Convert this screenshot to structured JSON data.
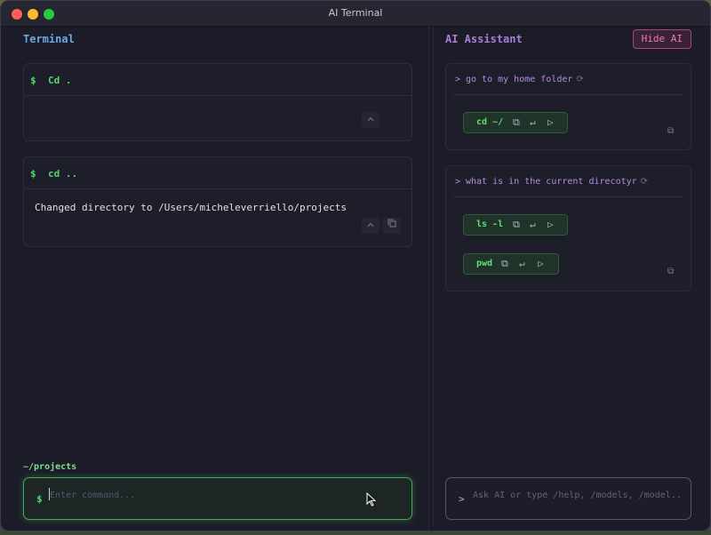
{
  "window": {
    "title": "AI Terminal"
  },
  "terminal": {
    "title": "Terminal",
    "blocks": [
      {
        "prompt": "$",
        "command": "Cd .",
        "output": ""
      },
      {
        "prompt": "$",
        "command": "cd ..",
        "output": "Changed directory to /Users/micheleverriello/projects"
      }
    ],
    "cwd": "~/projects",
    "input": {
      "prompt": "$",
      "placeholder": "Enter command...",
      "value": ""
    }
  },
  "assistant": {
    "title": "AI Assistant",
    "hide_label": "Hide AI",
    "cards": [
      {
        "prompt": ">",
        "query": "go to my home folder",
        "suggestions": [
          "cd ~/"
        ]
      },
      {
        "prompt": ">",
        "query": "what is in the current direcotyr",
        "suggestions": [
          "ls -l",
          "pwd"
        ]
      }
    ],
    "input": {
      "prompt": ">",
      "placeholder": "Ask AI or type /help, /models, /model...",
      "value": ""
    }
  },
  "icons": {
    "collapse": "chevron-up-icon",
    "copy": "copy-icon",
    "insert": "enter-icon",
    "run": "play-icon",
    "regenerate": "refresh-icon"
  },
  "colors": {
    "terminal_title": "#6fa8dc",
    "assistant_title": "#a77fd6",
    "command_green": "#4fd96c",
    "hide_ai": "#f078b4"
  }
}
